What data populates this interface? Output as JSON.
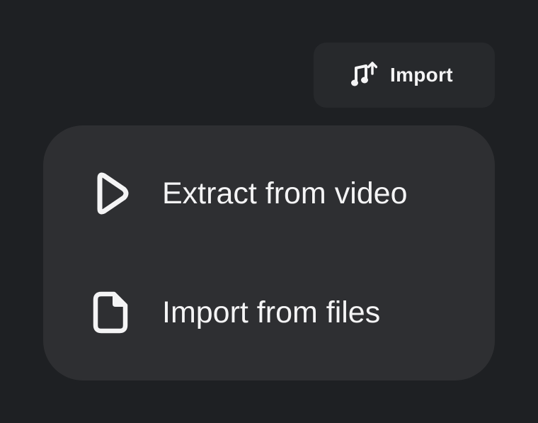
{
  "import_button": {
    "label": "Import",
    "icon": "music-note-upload-icon"
  },
  "menu": {
    "items": [
      {
        "label": "Extract from video",
        "icon": "play-icon"
      },
      {
        "label": "Import from files",
        "icon": "document-icon"
      }
    ]
  },
  "colors": {
    "background": "#1e2023",
    "button_background": "#27292c",
    "menu_background": "#2e2f32",
    "text": "#f4f4f5"
  }
}
